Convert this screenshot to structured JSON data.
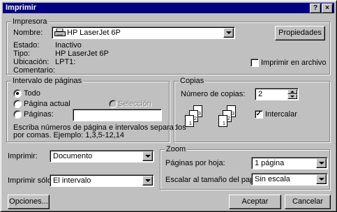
{
  "window": {
    "title": "Imprimir",
    "help_label": "?",
    "close_label": "×"
  },
  "printer": {
    "group_label": "Impresora",
    "name_label": "Nombre:",
    "name_value": "HP LaserJet 6P",
    "properties_button": "Propiedades",
    "status_label": "Estado:",
    "status_value": "Inactivo",
    "type_label": "Tipo:",
    "type_value": "HP LaserJet 6P",
    "location_label": "Ubicación:",
    "location_value": "LPT1:",
    "comment_label": "Comentario:",
    "print_to_file_label": "Imprimir en archivo"
  },
  "range": {
    "group_label": "Intervalo de páginas",
    "all_label": "Todo",
    "current_label": "Página actual",
    "selection_label": "Selección",
    "pages_label": "Páginas:",
    "pages_value": "",
    "hint": "Escriba números de página e intervalos separados",
    "hint2": "por comas. Ejemplo: 1,3,5-12,14"
  },
  "copies": {
    "group_label": "Copias",
    "count_label": "Número de copias:",
    "count_value": "2",
    "collate_label": "Intercalar",
    "collate_checked": true
  },
  "print_what": {
    "label": "Imprimir:",
    "value": "Documento"
  },
  "print_only": {
    "label": "Imprimir sólo:",
    "value": "El intervalo"
  },
  "zoom": {
    "group_label": "Zoom",
    "per_sheet_label": "Páginas por hoja:",
    "per_sheet_value": "1 página",
    "scale_label": "Escalar al tamaño del papel:",
    "scale_value": "Sin escala"
  },
  "footer": {
    "options_button": "Opciones...",
    "ok_button": "Aceptar",
    "cancel_button": "Cancelar"
  },
  "icons": [
    "printer-icon",
    "collate-pages-icon"
  ]
}
